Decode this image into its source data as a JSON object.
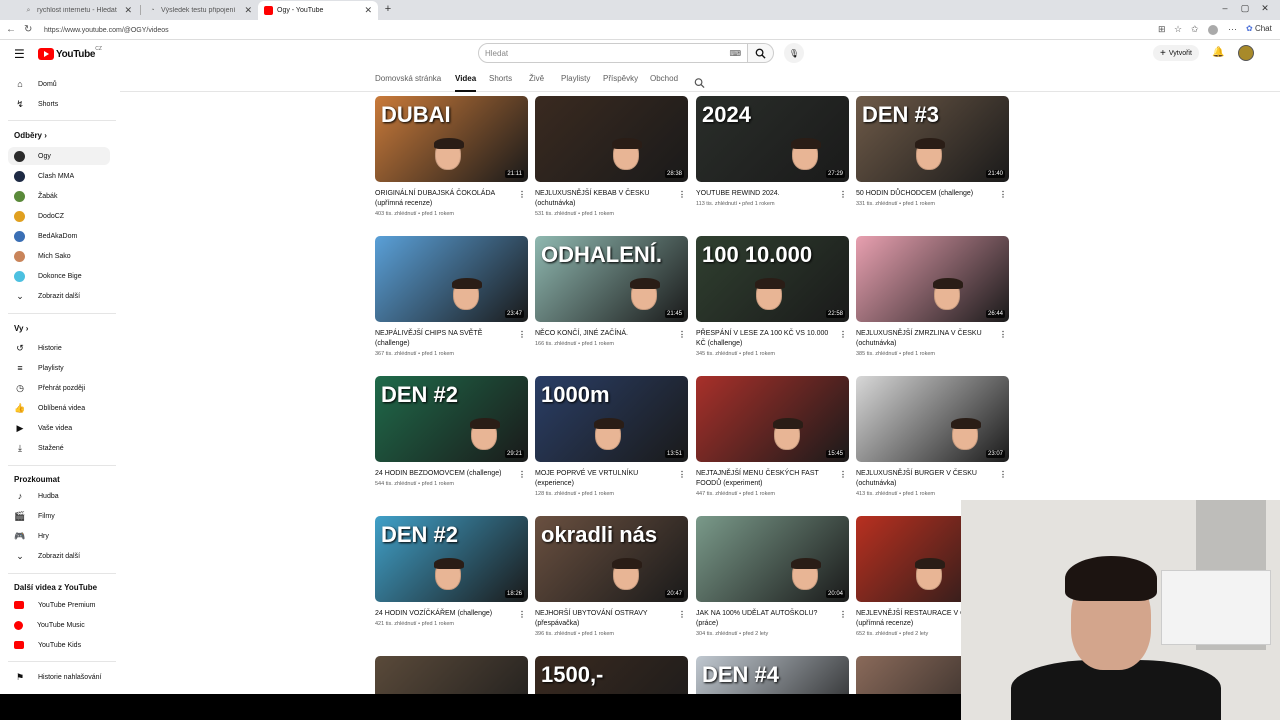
{
  "browser": {
    "tabs": [
      {
        "title": "rychlost internetu - Hledat"
      },
      {
        "title": "Výsledek testu připojení"
      },
      {
        "title": "Ogy - YouTube"
      }
    ],
    "url": "https://www.youtube.com/@OGY/videos",
    "chat_label": "Chat"
  },
  "header": {
    "logo_text": "YouTube",
    "logo_country": "CZ",
    "search_placeholder": "Hledat",
    "create_label": "Vytvořit"
  },
  "sidebar": {
    "main": [
      {
        "label": "Domů",
        "icon": "home-icon"
      },
      {
        "label": "Shorts",
        "icon": "shorts-icon"
      }
    ],
    "subs_heading": "Odběry",
    "subs": [
      {
        "label": "Ogy",
        "color": "#2b2b2b"
      },
      {
        "label": "Clash MMA",
        "color": "#1e2a44"
      },
      {
        "label": "Žabák",
        "color": "#5a8a3a"
      },
      {
        "label": "DodoCZ",
        "color": "#e0a020"
      },
      {
        "label": "BedAkaDom",
        "color": "#3a6fb5"
      },
      {
        "label": "Mich Sako",
        "color": "#c9845a"
      },
      {
        "label": "Dokonce Bige",
        "color": "#4cc0e0"
      }
    ],
    "show_more": "Zobrazit další",
    "you_heading": "Vy",
    "you": [
      {
        "label": "Historie",
        "icon": "history-icon"
      },
      {
        "label": "Playlisty",
        "icon": "playlists-icon"
      },
      {
        "label": "Přehrát později",
        "icon": "watch-later-icon"
      },
      {
        "label": "Oblíbená videa",
        "icon": "like-icon"
      },
      {
        "label": "Vaše videa",
        "icon": "your-videos-icon"
      },
      {
        "label": "Stažené",
        "icon": "download-icon"
      }
    ],
    "explore_heading": "Prozkoumat",
    "explore": [
      {
        "label": "Hudba",
        "icon": "music-icon"
      },
      {
        "label": "Filmy",
        "icon": "movies-icon"
      },
      {
        "label": "Hry",
        "icon": "gaming-icon"
      }
    ],
    "explore_more": "Zobrazit další",
    "more_heading": "Další videa z YouTube",
    "more": [
      {
        "label": "YouTube Premium"
      },
      {
        "label": "YouTube Music"
      },
      {
        "label": "YouTube Kids"
      }
    ],
    "report": "Historie nahlašování"
  },
  "channel_tabs": [
    "Domovská stránka",
    "Videa",
    "Shorts",
    "Živě",
    "Playlisty",
    "Příspěvky",
    "Obchod"
  ],
  "active_tab": "Videa",
  "videos": [
    {
      "title": "ORIGINÁLNÍ DUBAJSKÁ ČOKOLÁDA (upřímná recenze)",
      "meta": "403 tis. zhlédnutí • před 1 rokem",
      "duration": "21:11",
      "overlay": "DUBAI",
      "bg": "#c97a3a"
    },
    {
      "title": "NEJLUXUSNĚJŠÍ KEBAB V ČESKU (ochutnávka)",
      "meta": "531 tis. zhlédnutí • před 1 rokem",
      "duration": "28:38",
      "overlay": "",
      "bg": "#3a2a20"
    },
    {
      "title": "YOUTUBE REWIND 2024.",
      "meta": "113 tis. zhlédnutí • před 1 rokem",
      "duration": "27:29",
      "overlay": "2024",
      "bg": "#2a2e2a"
    },
    {
      "title": "50 HODIN DŮCHODCEM (challenge)",
      "meta": "331 tis. zhlédnutí • před 1 rokem",
      "duration": "21:40",
      "overlay": "DEN #3",
      "bg": "#6e5a48"
    },
    {
      "title": "NEJPÁLIVĚJŠÍ CHIPS NA SVĚTĚ (challenge)",
      "meta": "367 tis. zhlédnutí • před 1 rokem",
      "duration": "23:47",
      "overlay": "",
      "bg": "#5aa0d8"
    },
    {
      "title": "NĚCO KONČÍ, JINÉ ZAČÍNÁ.",
      "meta": "166 tis. zhlédnutí • před 1 rokem",
      "duration": "21:45",
      "overlay": "ODHALENÍ.",
      "bg": "#8fb8b0"
    },
    {
      "title": "PŘESPÁNÍ V LESE ZA 100 KČ VS 10.000 KČ (challenge)",
      "meta": "345 tis. zhlédnutí • před 1 rokem",
      "duration": "22:58",
      "overlay": "100 10.000",
      "bg": "#304030"
    },
    {
      "title": "NEJLUXUSNĚJŠÍ ZMRZLINA V ČESKU (ochutnávka)",
      "meta": "385 tis. zhlédnutí • před 1 rokem",
      "duration": "26:44",
      "overlay": "",
      "bg": "#e8a0b0"
    },
    {
      "title": "24 HODIN BEZDOMOVCEM (challenge)",
      "meta": "544 tis. zhlédnutí • před 1 rokem",
      "duration": "29:21",
      "overlay": "DEN #2",
      "bg": "#1f6a4a"
    },
    {
      "title": "MOJE POPRVÉ VE VRTULNÍKU (experience)",
      "meta": "128 tis. zhlédnutí • před 1 rokem",
      "duration": "13:51",
      "overlay": "1000m",
      "bg": "#2a3e66"
    },
    {
      "title": "NEJTAJNĚJŠÍ MENU ČESKÝCH FAST FOODŮ (experiment)",
      "meta": "447 tis. zhlédnutí • před 1 rokem",
      "duration": "15:45",
      "overlay": "",
      "bg": "#a8302a"
    },
    {
      "title": "NEJLUXUSNĚJŠÍ BURGER V ČESKU (ochutnávka)",
      "meta": "413 tis. zhlédnutí • před 1 rokem",
      "duration": "23:07",
      "overlay": "",
      "bg": "#d8d8d8"
    },
    {
      "title": "24 HODIN VOZÍČKÁŘEM (challenge)",
      "meta": "421 tis. zhlédnutí • před 1 rokem",
      "duration": "18:26",
      "overlay": "DEN #2",
      "bg": "#40a0c8"
    },
    {
      "title": "NEJHORŠÍ UBYTOVÁNÍ OSTRAVY (přespávačka)",
      "meta": "396 tis. zhlédnutí • před 1 rokem",
      "duration": "20:47",
      "overlay": "okradli nás",
      "bg": "#6a5040"
    },
    {
      "title": "JAK NA 100% UDĚLAT AUTOŠKOLU? (práce)",
      "meta": "304 tis. zhlédnutí • před 2 lety",
      "duration": "20:04",
      "overlay": "",
      "bg": "#7a9a8a"
    },
    {
      "title": "NEJLEVNĚJŠÍ RESTAURACE V ČESKU (upřímná recenze)",
      "meta": "652 tis. zhlédnutí • před 2 lety",
      "duration": "",
      "overlay": "",
      "bg": "#b83020"
    },
    {
      "title": "",
      "meta": "",
      "duration": "",
      "overlay": "",
      "bg": "#5a4a3a"
    },
    {
      "title": "",
      "meta": "",
      "duration": "",
      "overlay": "1500,-",
      "bg": "#3a2a20"
    },
    {
      "title": "",
      "meta": "",
      "duration": "",
      "overlay": "DEN #4",
      "bg": "#c0c8d0"
    },
    {
      "title": "",
      "meta": "",
      "duration": "",
      "overlay": "",
      "bg": "#8a6a5a"
    }
  ]
}
